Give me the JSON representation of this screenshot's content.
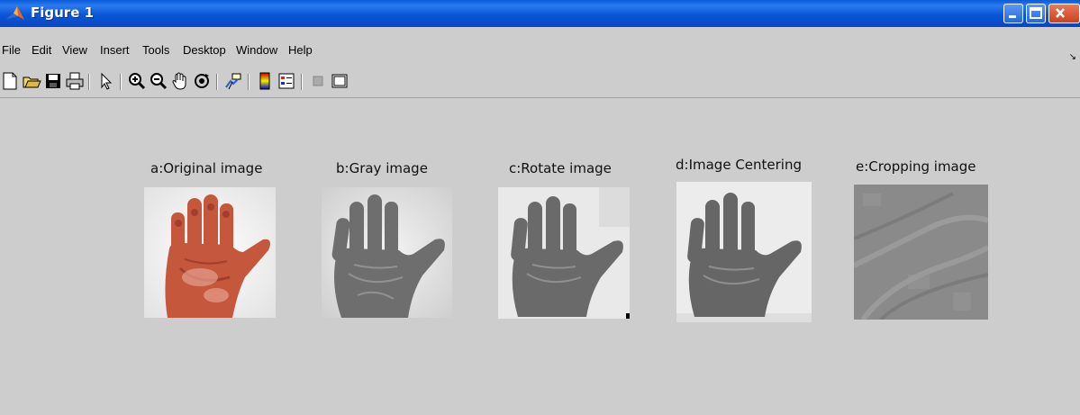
{
  "window": {
    "title": "Figure 1"
  },
  "menu": [
    "File",
    "Edit",
    "View",
    "Insert",
    "Tools",
    "Desktop",
    "Window",
    "Help"
  ],
  "toolbar": [
    "new-figure-icon",
    "open-file-icon",
    "save-figure-icon",
    "print-figure-icon",
    "edit-plot-arrow-icon",
    "zoom-in-icon",
    "zoom-out-icon",
    "pan-hand-icon",
    "rotate-3d-icon",
    "data-cursor-icon",
    "insert-colorbar-icon",
    "insert-legend-icon",
    "hide-plot-tools-icon",
    "show-plot-tools-icon"
  ],
  "panels": [
    {
      "label": "a:Original image"
    },
    {
      "label": "b:Gray image"
    },
    {
      "label": "c:Rotate image"
    },
    {
      "label": "d:Image Centering"
    },
    {
      "label": "e:Cropping image"
    }
  ],
  "colors": {
    "titlebar": "#0b56d6",
    "figure_bg": "#cdcdcd",
    "skin": "#c5573d",
    "gray_hand": "#6e6e6e",
    "crop": "#8a8a8a"
  }
}
